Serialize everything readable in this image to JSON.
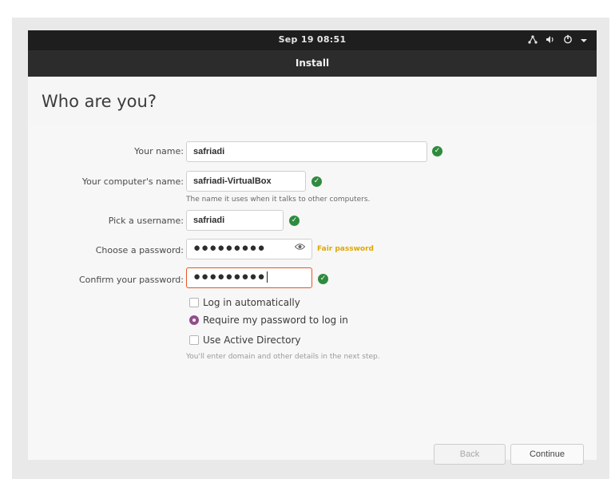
{
  "topbar": {
    "clock": "Sep 19  08:51",
    "icons": [
      "network-icon",
      "volume-icon",
      "power-icon",
      "menu-arrow-icon"
    ]
  },
  "window": {
    "title": "Install"
  },
  "page": {
    "heading": "Who are you?"
  },
  "form": {
    "name_label": "Your name:",
    "name_value": "safriadi",
    "computer_label": "Your computer's name:",
    "computer_value": "safriadi-VirtualBox",
    "computer_hint": "The name it uses when it talks to other computers.",
    "username_label": "Pick a username:",
    "username_value": "safriadi",
    "password_label": "Choose a password:",
    "password_value": "●●●●●●●●●",
    "password_strength": "Fair password",
    "confirm_label": "Confirm your password:",
    "confirm_value": "●●●●●●●●●"
  },
  "options": {
    "login_auto": "Log in automatically",
    "require_password": "Require my password to log in",
    "active_directory": "Use Active Directory",
    "ad_note": "You'll enter domain and other details in the next step."
  },
  "buttons": {
    "back": "Back",
    "continue": "Continue"
  },
  "colors": {
    "ok_green": "#2e8b3e",
    "accent_orange": "#e95420",
    "radio_purple": "#924d8b",
    "strength_yellow": "#e0a800"
  }
}
